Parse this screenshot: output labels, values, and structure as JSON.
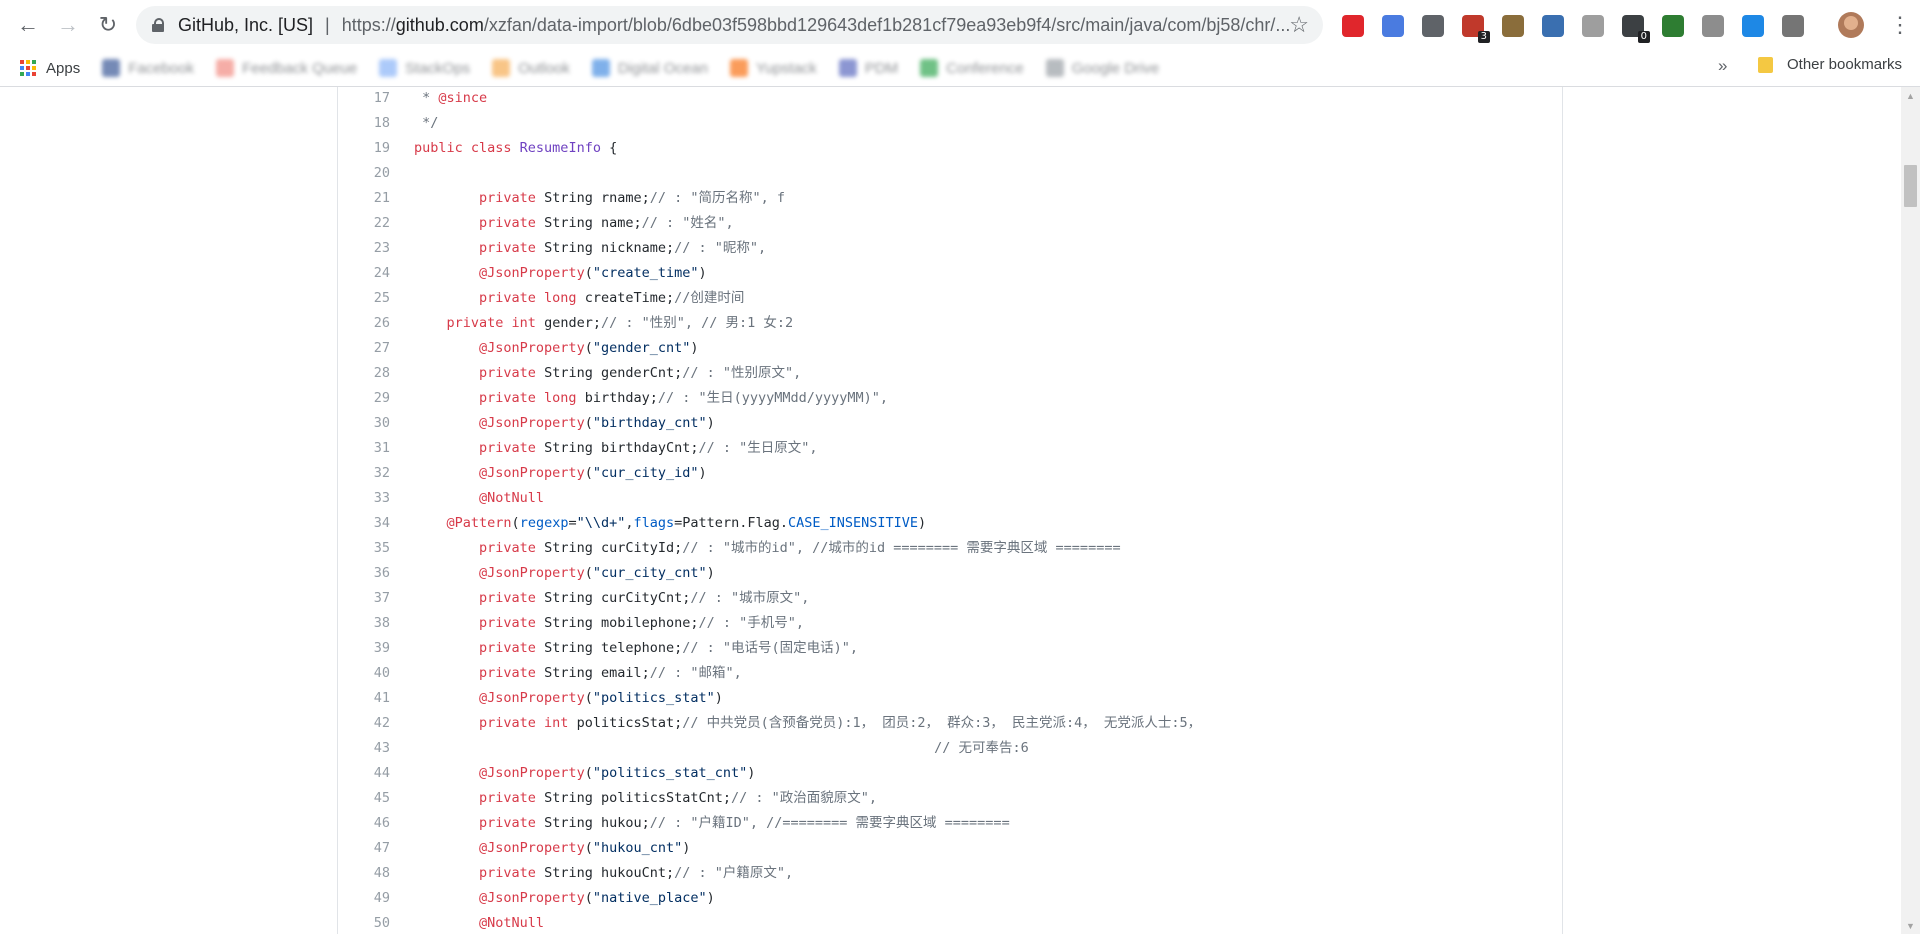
{
  "browser": {
    "site_identity": "GitHub, Inc. [US]",
    "separator": "|",
    "url_scheme": "https://",
    "url_host": "github.com",
    "url_path": "/xzfan/data-import/blob/6dbe03f598bbd129643def1b281cf79ea93eb9f4/src/main/java/com/bj58/chr/...",
    "back_icon": "←",
    "forward_icon": "→",
    "reload_icon": "↻",
    "star_icon": "☆",
    "menu_icon": "⋮",
    "extensions": [
      {
        "name": "opera-icon",
        "color": "#e0262c",
        "badge": ""
      },
      {
        "name": "translate-icon",
        "color": "#4a7be0",
        "badge": ""
      },
      {
        "name": "mail-icon",
        "color": "#5f6368",
        "badge": ""
      },
      {
        "name": "extension-red-icon",
        "color": "#c0392b",
        "badge": "3"
      },
      {
        "name": "extension-figure-icon",
        "color": "#8a6d3b",
        "badge": ""
      },
      {
        "name": "extension-blue-icon",
        "color": "#3a6fb0",
        "badge": ""
      },
      {
        "name": "extension-grey-icon",
        "color": "#9e9e9e",
        "badge": ""
      },
      {
        "name": "link-icon",
        "color": "#3c4043",
        "badge": "0"
      },
      {
        "name": "extension-green-icon",
        "color": "#2e7d32",
        "badge": ""
      },
      {
        "name": "extension-circle-icon",
        "color": "#8d8d8d",
        "badge": ""
      },
      {
        "name": "extension-s-icon",
        "color": "#1e88e5",
        "badge": ""
      },
      {
        "name": "extension-binary-icon",
        "color": "#757575",
        "badge": ""
      }
    ]
  },
  "bookmarks": {
    "apps_label": "Apps",
    "items": [
      {
        "label": "Facebook",
        "color": "#3b5998"
      },
      {
        "label": "Feedback Queue",
        "color": "#f28b82"
      },
      {
        "label": "StackOps",
        "color": "#8ab4f8"
      },
      {
        "label": "Outlook",
        "color": "#f6ad55"
      },
      {
        "label": "Digital Ocean",
        "color": "#4a90e2"
      },
      {
        "label": "Yupstack",
        "color": "#f97316"
      },
      {
        "label": "PDM",
        "color": "#5c6bc0"
      },
      {
        "label": "Conference",
        "color": "#34a853"
      },
      {
        "label": "Google Drive",
        "color": "#9aa0a6"
      }
    ],
    "chevron": "»",
    "other_label": "Other bookmarks"
  },
  "code": {
    "lines": [
      {
        "n": "17",
        "indent": 0,
        "tokens": [
          {
            "t": " * ",
            "c": "cmt"
          },
          {
            "t": "@since",
            "c": "kw"
          }
        ]
      },
      {
        "n": "18",
        "indent": 0,
        "tokens": [
          {
            "t": " */",
            "c": "cmt"
          }
        ]
      },
      {
        "n": "19",
        "indent": 0,
        "tokens": [
          {
            "t": "public class ",
            "c": "kw"
          },
          {
            "t": "ResumeInfo",
            "c": "ent"
          },
          {
            "t": " {",
            "c": ""
          }
        ]
      },
      {
        "n": "20",
        "indent": 0,
        "tokens": []
      },
      {
        "n": "21",
        "indent": 8,
        "tokens": [
          {
            "t": "private ",
            "c": "kw"
          },
          {
            "t": "String rname;",
            "c": ""
          },
          {
            "t": "// : \"简历名称\", f",
            "c": "cmt"
          }
        ]
      },
      {
        "n": "22",
        "indent": 8,
        "tokens": [
          {
            "t": "private ",
            "c": "kw"
          },
          {
            "t": "String name;",
            "c": ""
          },
          {
            "t": "// : \"姓名\",",
            "c": "cmt"
          }
        ]
      },
      {
        "n": "23",
        "indent": 8,
        "tokens": [
          {
            "t": "private ",
            "c": "kw"
          },
          {
            "t": "String nickname;",
            "c": ""
          },
          {
            "t": "// : \"昵称\",",
            "c": "cmt"
          }
        ]
      },
      {
        "n": "24",
        "indent": 8,
        "tokens": [
          {
            "t": "@JsonProperty",
            "c": "ann"
          },
          {
            "t": "(",
            "c": ""
          },
          {
            "t": "\"create_time\"",
            "c": "str"
          },
          {
            "t": ")",
            "c": ""
          }
        ]
      },
      {
        "n": "25",
        "indent": 8,
        "tokens": [
          {
            "t": "private long ",
            "c": "kw"
          },
          {
            "t": "createTime;",
            "c": ""
          },
          {
            "t": "//创建时间",
            "c": "cmt"
          }
        ]
      },
      {
        "n": "26",
        "indent": 4,
        "tokens": [
          {
            "t": "private int ",
            "c": "kw"
          },
          {
            "t": "gender;",
            "c": ""
          },
          {
            "t": "// : \"性别\", // 男:1 女:2",
            "c": "cmt"
          }
        ]
      },
      {
        "n": "27",
        "indent": 8,
        "tokens": [
          {
            "t": "@JsonProperty",
            "c": "ann"
          },
          {
            "t": "(",
            "c": ""
          },
          {
            "t": "\"gender_cnt\"",
            "c": "str"
          },
          {
            "t": ")",
            "c": ""
          }
        ]
      },
      {
        "n": "28",
        "indent": 8,
        "tokens": [
          {
            "t": "private ",
            "c": "kw"
          },
          {
            "t": "String genderCnt;",
            "c": ""
          },
          {
            "t": "// : \"性别原文\",",
            "c": "cmt"
          }
        ]
      },
      {
        "n": "29",
        "indent": 8,
        "tokens": [
          {
            "t": "private long ",
            "c": "kw"
          },
          {
            "t": "birthday;",
            "c": ""
          },
          {
            "t": "// : \"生日(yyyyMMdd/yyyyMM)\",",
            "c": "cmt"
          }
        ]
      },
      {
        "n": "30",
        "indent": 8,
        "tokens": [
          {
            "t": "@JsonProperty",
            "c": "ann"
          },
          {
            "t": "(",
            "c": ""
          },
          {
            "t": "\"birthday_cnt\"",
            "c": "str"
          },
          {
            "t": ")",
            "c": ""
          }
        ]
      },
      {
        "n": "31",
        "indent": 8,
        "tokens": [
          {
            "t": "private ",
            "c": "kw"
          },
          {
            "t": "String birthdayCnt;",
            "c": ""
          },
          {
            "t": "// : \"生日原文\",",
            "c": "cmt"
          }
        ]
      },
      {
        "n": "32",
        "indent": 8,
        "tokens": [
          {
            "t": "@JsonProperty",
            "c": "ann"
          },
          {
            "t": "(",
            "c": ""
          },
          {
            "t": "\"cur_city_id\"",
            "c": "str"
          },
          {
            "t": ")",
            "c": ""
          }
        ]
      },
      {
        "n": "33",
        "indent": 8,
        "tokens": [
          {
            "t": "@NotNull",
            "c": "ann"
          }
        ]
      },
      {
        "n": "34",
        "indent": 4,
        "tokens": [
          {
            "t": "@Pattern",
            "c": "ann"
          },
          {
            "t": "(",
            "c": ""
          },
          {
            "t": "regexp",
            "c": "cst"
          },
          {
            "t": "=",
            "c": ""
          },
          {
            "t": "\"\\\\d+\"",
            "c": "str"
          },
          {
            "t": ",",
            "c": ""
          },
          {
            "t": "flags",
            "c": "cst"
          },
          {
            "t": "=Pattern.Flag.",
            "c": ""
          },
          {
            "t": "CASE_INSENSITIVE",
            "c": "cst"
          },
          {
            "t": ")",
            "c": ""
          }
        ]
      },
      {
        "n": "35",
        "indent": 8,
        "tokens": [
          {
            "t": "private ",
            "c": "kw"
          },
          {
            "t": "String curCityId;",
            "c": ""
          },
          {
            "t": "// : \"城市的id\", //城市的id ======== 需要字典区域 ========",
            "c": "cmt"
          }
        ]
      },
      {
        "n": "36",
        "indent": 8,
        "tokens": [
          {
            "t": "@JsonProperty",
            "c": "ann"
          },
          {
            "t": "(",
            "c": ""
          },
          {
            "t": "\"cur_city_cnt\"",
            "c": "str"
          },
          {
            "t": ")",
            "c": ""
          }
        ]
      },
      {
        "n": "37",
        "indent": 8,
        "tokens": [
          {
            "t": "private ",
            "c": "kw"
          },
          {
            "t": "String curCityCnt;",
            "c": ""
          },
          {
            "t": "// : \"城市原文\",",
            "c": "cmt"
          }
        ]
      },
      {
        "n": "38",
        "indent": 8,
        "tokens": [
          {
            "t": "private ",
            "c": "kw"
          },
          {
            "t": "String mobilephone;",
            "c": ""
          },
          {
            "t": "// : \"手机号\",",
            "c": "cmt"
          }
        ]
      },
      {
        "n": "39",
        "indent": 8,
        "tokens": [
          {
            "t": "private ",
            "c": "kw"
          },
          {
            "t": "String telephone;",
            "c": ""
          },
          {
            "t": "// : \"电话号(固定电话)\",",
            "c": "cmt"
          }
        ]
      },
      {
        "n": "40",
        "indent": 8,
        "tokens": [
          {
            "t": "private ",
            "c": "kw"
          },
          {
            "t": "String email;",
            "c": ""
          },
          {
            "t": "// : \"邮箱\",",
            "c": "cmt"
          }
        ]
      },
      {
        "n": "41",
        "indent": 8,
        "tokens": [
          {
            "t": "@JsonProperty",
            "c": "ann"
          },
          {
            "t": "(",
            "c": ""
          },
          {
            "t": "\"politics_stat\"",
            "c": "str"
          },
          {
            "t": ")",
            "c": ""
          }
        ]
      },
      {
        "n": "42",
        "indent": 8,
        "tokens": [
          {
            "t": "private int ",
            "c": "kw"
          },
          {
            "t": "politicsStat;",
            "c": ""
          },
          {
            "t": "// 中共党员(含预备党员):1， 团员:2， 群众:3， 民主党派:4， 无党派人士:5，",
            "c": "cmt"
          }
        ]
      },
      {
        "n": "43",
        "indent": 64,
        "tokens": [
          {
            "t": "// 无可奉告:6",
            "c": "cmt"
          }
        ]
      },
      {
        "n": "44",
        "indent": 8,
        "tokens": [
          {
            "t": "@JsonProperty",
            "c": "ann"
          },
          {
            "t": "(",
            "c": ""
          },
          {
            "t": "\"politics_stat_cnt\"",
            "c": "str"
          },
          {
            "t": ")",
            "c": ""
          }
        ]
      },
      {
        "n": "45",
        "indent": 8,
        "tokens": [
          {
            "t": "private ",
            "c": "kw"
          },
          {
            "t": "String politicsStatCnt;",
            "c": ""
          },
          {
            "t": "// : \"政治面貌原文\",",
            "c": "cmt"
          }
        ]
      },
      {
        "n": "46",
        "indent": 8,
        "tokens": [
          {
            "t": "private ",
            "c": "kw"
          },
          {
            "t": "String hukou;",
            "c": ""
          },
          {
            "t": "// : \"户籍ID\", //======== 需要字典区域 ========",
            "c": "cmt"
          }
        ]
      },
      {
        "n": "47",
        "indent": 8,
        "tokens": [
          {
            "t": "@JsonProperty",
            "c": "ann"
          },
          {
            "t": "(",
            "c": ""
          },
          {
            "t": "\"hukou_cnt\"",
            "c": "str"
          },
          {
            "t": ")",
            "c": ""
          }
        ]
      },
      {
        "n": "48",
        "indent": 8,
        "tokens": [
          {
            "t": "private ",
            "c": "kw"
          },
          {
            "t": "String hukouCnt;",
            "c": ""
          },
          {
            "t": "// : \"户籍原文\",",
            "c": "cmt"
          }
        ]
      },
      {
        "n": "49",
        "indent": 8,
        "tokens": [
          {
            "t": "@JsonProperty",
            "c": "ann"
          },
          {
            "t": "(",
            "c": ""
          },
          {
            "t": "\"native_place\"",
            "c": "str"
          },
          {
            "t": ")",
            "c": ""
          }
        ]
      },
      {
        "n": "50",
        "indent": 8,
        "tokens": [
          {
            "t": "@NotNull",
            "c": "ann"
          }
        ]
      }
    ]
  }
}
